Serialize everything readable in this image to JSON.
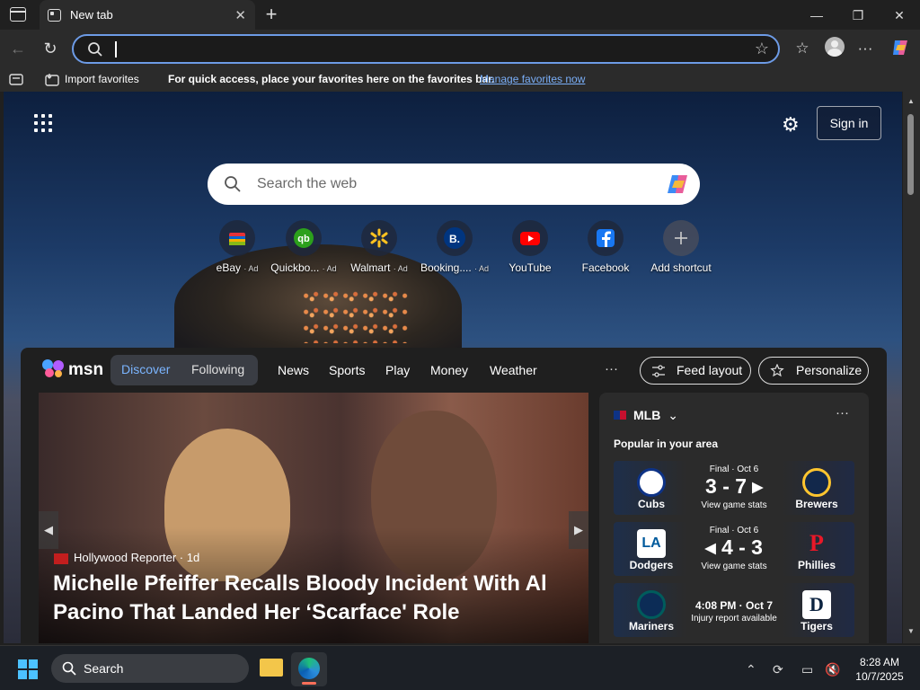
{
  "browser": {
    "tab_title": "New tab",
    "address_value": "",
    "favorites_bar": {
      "import_label": "Import favorites",
      "hint": "For quick access, place your favorites here on the favorites bar.",
      "manage_link": "Manage favorites now"
    }
  },
  "newtab": {
    "signin_label": "Sign in",
    "search_placeholder": "Search the web",
    "shortcuts": [
      {
        "label": "eBay",
        "ad": "· Ad",
        "icon": "ebay-icon"
      },
      {
        "label": "Quickbo...",
        "ad": "· Ad",
        "icon": "quickbooks-icon"
      },
      {
        "label": "Walmart",
        "ad": "· Ad",
        "icon": "walmart-icon"
      },
      {
        "label": "Booking....",
        "ad": "· Ad",
        "icon": "booking-icon"
      },
      {
        "label": "YouTube",
        "ad": "",
        "icon": "youtube-icon"
      },
      {
        "label": "Facebook",
        "ad": "",
        "icon": "facebook-icon"
      },
      {
        "label": "Add shortcut",
        "ad": "",
        "icon": "plus-icon"
      }
    ]
  },
  "feed": {
    "brand": "msn",
    "tabs": {
      "discover": "Discover",
      "following": "Following"
    },
    "nav": [
      "News",
      "Sports",
      "Play",
      "Money",
      "Weather"
    ],
    "more": "···",
    "feed_layout": "Feed layout",
    "personalize": "Personalize",
    "hero": {
      "source": "Hollywood Reporter · 1d",
      "headline": "Michelle Pfeiffer Recalls Bloody Incident With Al Pacino That Landed Her ‘Scarface' Role"
    },
    "mlb": {
      "title": "MLB",
      "subtitle": "Popular in your area",
      "games": [
        {
          "status": "Final · Oct 6",
          "score": "3 - 7 ▸",
          "link": "View game stats",
          "away": "Cubs",
          "home": "Brewers"
        },
        {
          "status": "Final · Oct 6",
          "score": "◂ 4 - 3",
          "link": "View game stats",
          "away": "Dodgers",
          "home": "Phillies"
        },
        {
          "time": "4:08 PM · Oct 7",
          "note": "Injury report available",
          "away": "Mariners",
          "home": "Tigers"
        }
      ]
    }
  },
  "taskbar": {
    "search_label": "Search",
    "time": "8:28 AM",
    "date": "10/7/2025"
  }
}
